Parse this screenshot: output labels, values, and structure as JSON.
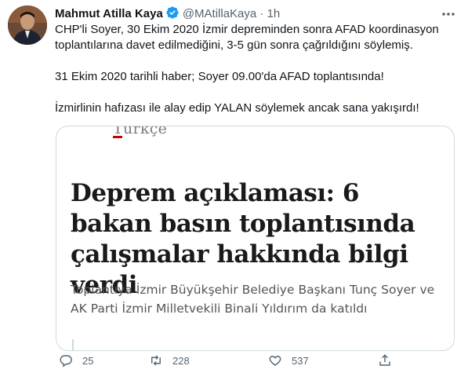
{
  "author": {
    "name": "Mahmut Atilla Kaya",
    "handle": "@MAtillaKaya",
    "separator": "·",
    "time": "1h"
  },
  "tweet": {
    "paragraphs": [
      "CHP'li Soyer, 30 Ekim 2020 İzmir depreminden sonra AFAD koordinasyon toplantılarına davet edilmediğini, 3-5 gün sonra çağrıldığını söylemiş.",
      "31 Ekim 2020 tarihli haber; Soyer 09.00'da AFAD toplantısında!",
      "İzmirlinin hafızası ile alay edip YALAN söylemek ancak sana yakışırdı!"
    ]
  },
  "card": {
    "source": "Türkçe",
    "headline": "Deprem açıklaması: 6 bakan basın toplantısında çalışmalar hakkında bilgi verdi",
    "summary": "Toplantıya İzmir Büyükşehir Belediye Başkanı Tunç Soyer ve AK Parti İzmir Milletvekili Binali Yıldırım da katıldı"
  },
  "actions": {
    "replies": "25",
    "retweets": "228",
    "likes": "537"
  },
  "colors": {
    "verified": "#1d9bf0",
    "muted": "#536471",
    "border": "#cfd9de"
  }
}
